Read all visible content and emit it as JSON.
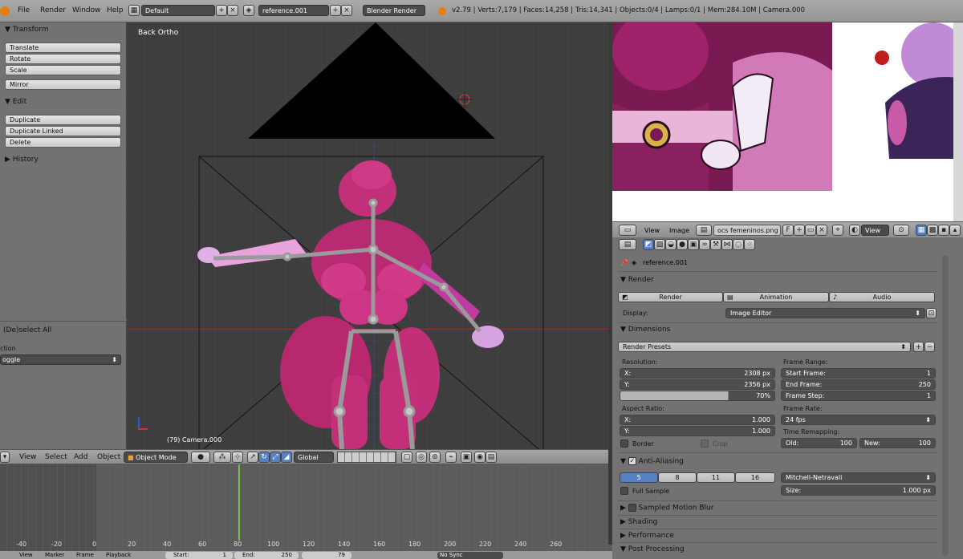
{
  "topbar": {
    "menus": [
      "File",
      "Render",
      "Window",
      "Help"
    ],
    "layout": "Default",
    "scene": "reference.001",
    "engine": "Blender Render",
    "stats": "v2.79 | Verts:7,179 | Faces:14,258 | Tris:14,341 | Objects:0/4 | Lamps:0/1 | Mem:284.10M | Camera.000"
  },
  "tools": {
    "transform_header": "Transform",
    "translate": "Translate",
    "rotate": "Rotate",
    "scale": "Scale",
    "mirror": "Mirror",
    "edit_header": "Edit",
    "duplicate": "Duplicate",
    "duplicate_linked": "Duplicate Linked",
    "delete": "Delete",
    "history_header": "History",
    "operator_title": "(De)select All",
    "action_label": "ction",
    "action_value": "oggle"
  },
  "viewport": {
    "view_name": "Back Ortho",
    "object_label": "(79) Camera.000"
  },
  "viewport_header": {
    "menus": [
      "View",
      "Select",
      "Add",
      "Object"
    ],
    "mode": "Object Mode",
    "orientation": "Global"
  },
  "timeline": {
    "frame_labels": [
      "-40",
      "-20",
      "0",
      "20",
      "40",
      "60",
      "80",
      "100",
      "120",
      "140",
      "160",
      "180",
      "200",
      "220",
      "240",
      "260"
    ],
    "footer_menus": [
      "View",
      "Marker",
      "Frame",
      "Playback"
    ],
    "start_label": "Start:",
    "start_value": "1",
    "end_label": "End:",
    "end_value": "250",
    "current_frame": "79",
    "sync": "No Sync"
  },
  "image_editor": {
    "menus": [
      "View",
      "Image"
    ],
    "image_name": "ocs femeninos.png",
    "f_label": "F",
    "view_label": "View"
  },
  "properties": {
    "context": "reference.001",
    "render_header": "Render",
    "render_button": "Render",
    "animation_button": "Animation",
    "audio_button": "Audio",
    "display_label": "Display:",
    "display_value": "Image Editor",
    "dimensions_header": "Dimensions",
    "render_presets": "Render Presets",
    "resolution_label": "Resolution:",
    "res_x_label": "X:",
    "res_x": "2308 px",
    "res_y_label": "Y:",
    "res_y": "2356 px",
    "res_percent": "70%",
    "frame_range_label": "Frame Range:",
    "start_frame_label": "Start Frame:",
    "start_frame": "1",
    "end_frame_label": "End Frame:",
    "end_frame": "250",
    "frame_step_label": "Frame Step:",
    "frame_step": "1",
    "aspect_label": "Aspect Ratio:",
    "aspect_x_label": "X:",
    "aspect_x": "1.000",
    "aspect_y_label": "Y:",
    "aspect_y": "1.000",
    "frame_rate_label": "Frame Rate:",
    "frame_rate": "24 fps",
    "border_label": "Border",
    "crop_label": "Crop",
    "time_remap_label": "Time Remapping:",
    "old_label": "Old:",
    "old_value": "100",
    "new_label": "New:",
    "new_value": "100",
    "aa_header": "Anti-Aliasing",
    "aa_samples": [
      "5",
      "8",
      "11",
      "16"
    ],
    "aa_filter": "Mitchell-Netravali",
    "full_sample_label": "Full Sample",
    "size_label": "Size:",
    "size_value": "1.000 px",
    "motion_blur_header": "Sampled Motion Blur",
    "shading_header": "Shading",
    "performance_header": "Performance",
    "post_processing_header": "Post Processing"
  },
  "colors": {
    "selected_blue": "#5680c2",
    "frame_cursor": "#6ec43a",
    "model_pink": "#c2307a"
  }
}
